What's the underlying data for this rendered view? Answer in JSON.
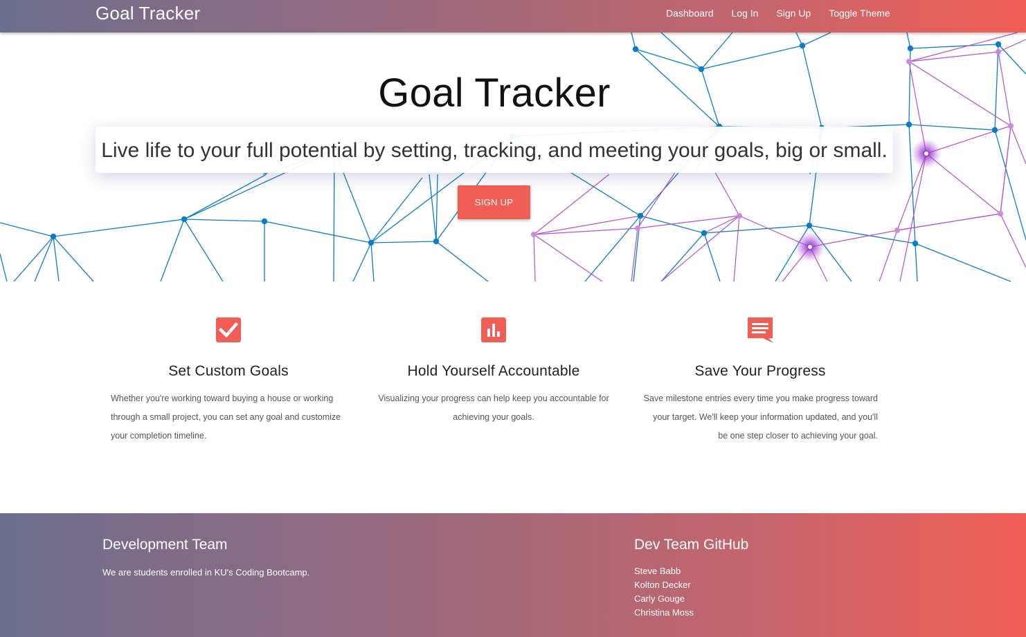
{
  "nav": {
    "brand": "Goal Tracker",
    "links": [
      "Dashboard",
      "Log In",
      "Sign Up",
      "Toggle Theme"
    ]
  },
  "hero": {
    "title": "Goal Tracker",
    "tagline": "Live life to your full potential by setting, tracking, and meeting your goals, big or small.",
    "signup_label": "Sign Up"
  },
  "features": [
    {
      "icon": "checkbox-icon",
      "title": "Set Custom Goals",
      "text": "Whether you're working toward buying a house or working through a small project, you can set any goal and customize your completion timeline."
    },
    {
      "icon": "bar-chart-icon",
      "title": "Hold Yourself Accountable",
      "text": "Visualizing your progress can help keep you accountable for achieving your goals."
    },
    {
      "icon": "chat-bubble-icon",
      "title": "Save Your Progress",
      "text": "Save milestone entries every time you make progress toward your target. We'll keep your information updated, and you'll be one step closer to achieving your goal."
    }
  ],
  "footer": {
    "team_heading": "Development Team",
    "team_text": "We are students enrolled in KU's Coding Bootcamp.",
    "github_heading": "Dev Team GitHub",
    "members": [
      "Steve Babb",
      "Kolton Decker",
      "Carly Gouge",
      "Christina Moss"
    ]
  },
  "colors": {
    "accent": "#f15e55",
    "gradient_start": "#6c6e8e",
    "gradient_end": "#f15e55",
    "network_blue": "#0a7cc9",
    "network_purple": "#b24fd0"
  }
}
